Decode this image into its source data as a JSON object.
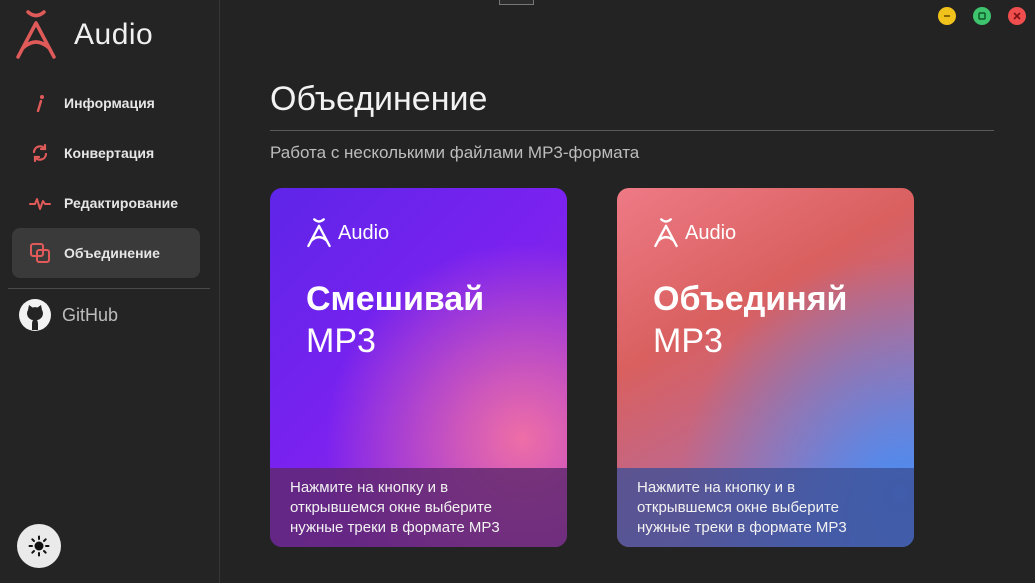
{
  "app": {
    "brand": "Audio"
  },
  "colors": {
    "accent": "#e05a5a",
    "window_minimize": "#f1c21b",
    "window_maximize": "#3ec46d",
    "window_close": "#f04e4e"
  },
  "sidebar": {
    "items": [
      {
        "label": "Информация",
        "icon": "info-icon"
      },
      {
        "label": "Конвертация",
        "icon": "convert-icon"
      },
      {
        "label": "Редактирование",
        "icon": "waveform-icon"
      },
      {
        "label": "Объединение",
        "icon": "merge-icon",
        "active": true
      }
    ],
    "github_label": "GitHub",
    "theme_icon": "sun-icon"
  },
  "main": {
    "title": "Объединение",
    "subtitle": "Работа с несколькими файлами MP3-формата",
    "cards": [
      {
        "brand": "Audio",
        "headline": "Смешивай",
        "subheadline": "MP3",
        "description_lines": [
          "Нажмите на кнопку и в",
          "открывшемся окне выберите",
          "нужные треки в формате MP3"
        ]
      },
      {
        "brand": "Audio",
        "headline": "Объединяй",
        "subheadline": "MP3",
        "description_lines": [
          "Нажмите на кнопку и в",
          "открывшемся окне выберите",
          "нужные треки в формате MP3"
        ]
      }
    ]
  }
}
